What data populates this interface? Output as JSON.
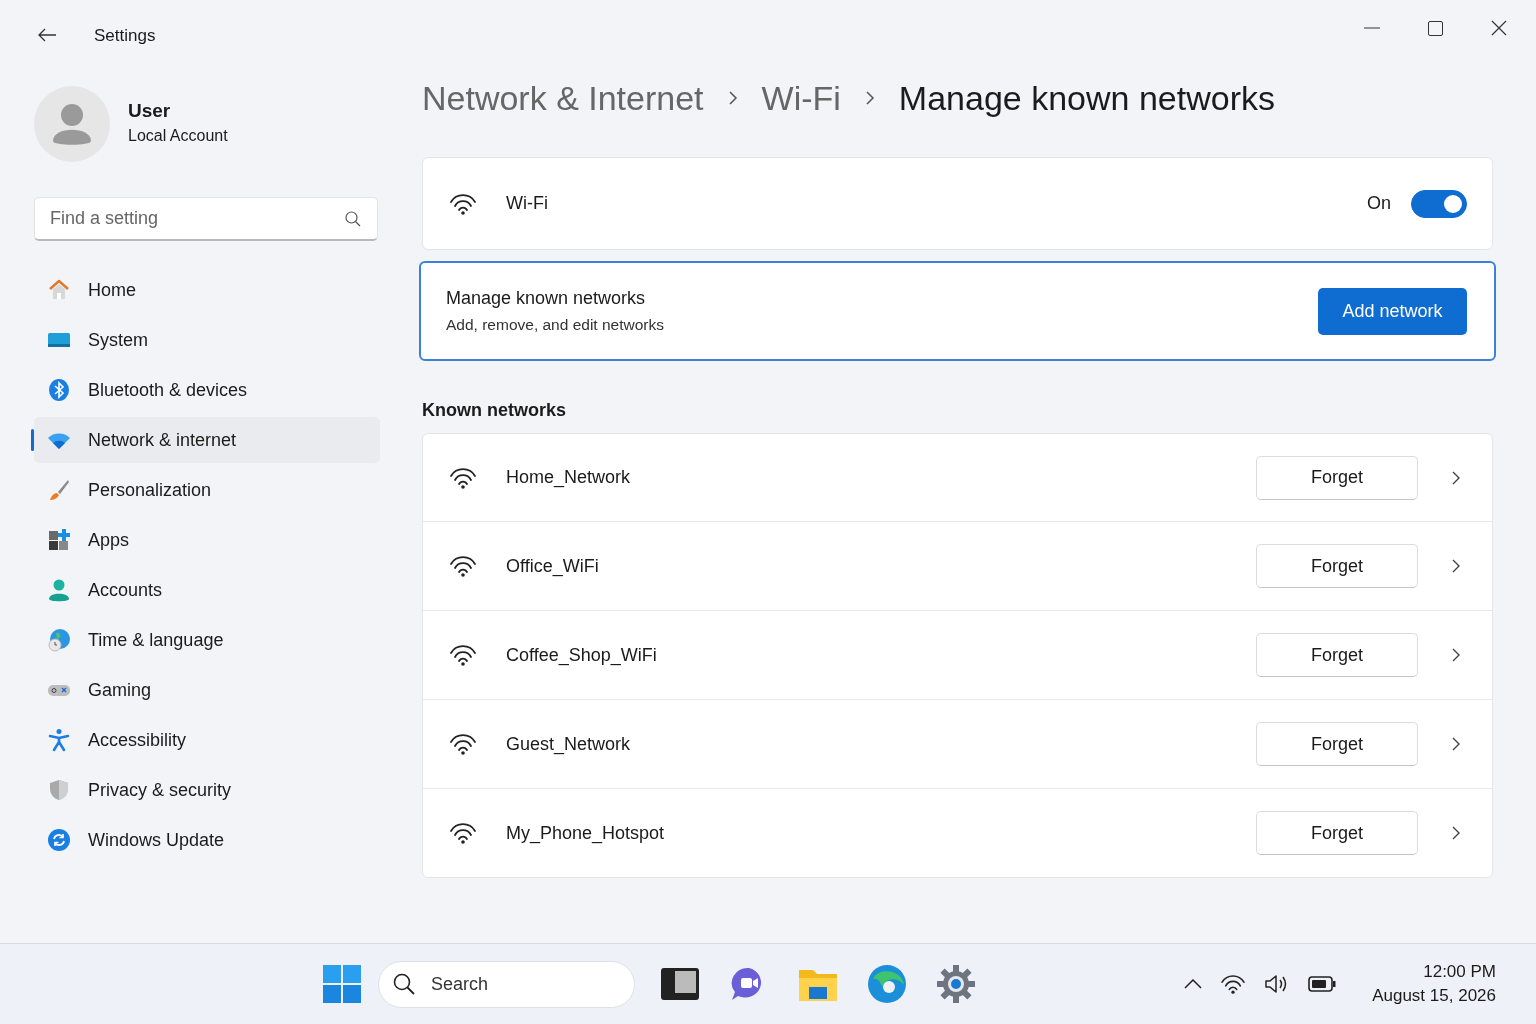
{
  "window": {
    "title": "Settings"
  },
  "user": {
    "name": "User",
    "account": "Local Account"
  },
  "search": {
    "placeholder": "Find a setting"
  },
  "nav": [
    {
      "label": "Home",
      "selected": false
    },
    {
      "label": "System",
      "selected": false
    },
    {
      "label": "Bluetooth & devices",
      "selected": false
    },
    {
      "label": "Network & internet",
      "selected": true
    },
    {
      "label": "Personalization",
      "selected": false
    },
    {
      "label": "Apps",
      "selected": false
    },
    {
      "label": "Accounts",
      "selected": false
    },
    {
      "label": "Time & language",
      "selected": false
    },
    {
      "label": "Gaming",
      "selected": false
    },
    {
      "label": "Accessibility",
      "selected": false
    },
    {
      "label": "Privacy & security",
      "selected": false
    },
    {
      "label": "Windows Update",
      "selected": false
    }
  ],
  "breadcrumb": [
    "Network & Internet",
    "Wi-Fi",
    "Manage known networks"
  ],
  "wifi": {
    "label": "Wi-Fi",
    "state": "On",
    "on": true
  },
  "manage": {
    "title": "Manage known networks",
    "subtitle": "Add, remove, and edit networks",
    "button": "Add network"
  },
  "known_networks": {
    "heading": "Known networks",
    "items": [
      {
        "name": "Home_Network",
        "action": "Forget"
      },
      {
        "name": "Office_WiFi",
        "action": "Forget"
      },
      {
        "name": "Coffee_Shop_WiFi",
        "action": "Forget"
      },
      {
        "name": "Guest_Network",
        "action": "Forget"
      },
      {
        "name": "My_Phone_Hotspot",
        "action": "Forget"
      }
    ]
  },
  "taskbar": {
    "search": {
      "placeholder": "Search"
    },
    "time": "12:00 PM",
    "date": "August 15, 2026"
  }
}
